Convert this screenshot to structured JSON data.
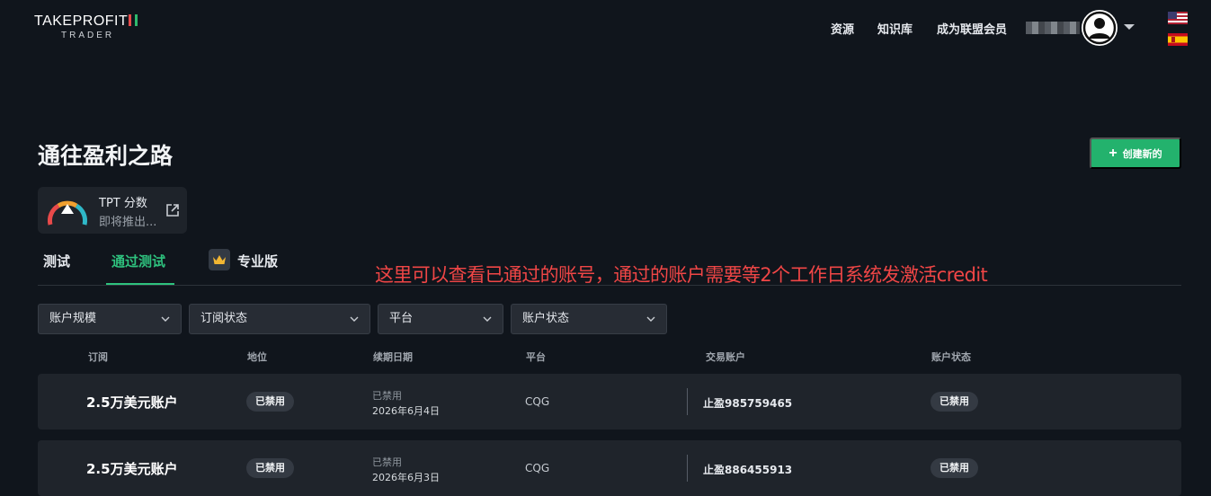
{
  "header": {
    "logo_top": "TAKEPROFIT",
    "logo_sub": "TRADER",
    "nav": [
      "资源",
      "知识库",
      "成为联盟会员"
    ],
    "avatar_icon": "user-circle-icon",
    "languages": [
      "us-flag-icon",
      "es-flag-icon"
    ]
  },
  "page": {
    "title": "通往盈利之路",
    "create_button": "创建新的",
    "create_color": "#23b26d"
  },
  "score_card": {
    "title": "TPT 分数",
    "subtitle": "即将推出...",
    "icon": "gauge-icon",
    "link_icon": "external-link-icon"
  },
  "tabs": [
    {
      "label": "测试",
      "active": false
    },
    {
      "label": "通过测试",
      "active": true
    },
    {
      "label": "专业版",
      "active": false,
      "icon": "crown-icon"
    }
  ],
  "annotation": "这里可以查看已通过的账号，通过的账户需要等2个工作日系统发激活credit",
  "filters": [
    "账户规模",
    "订阅状态",
    "平台",
    "账户状态"
  ],
  "table": {
    "headers": [
      "订阅",
      "地位",
      "续期日期",
      "平台",
      "交易账户",
      "账户状态"
    ],
    "rows": [
      {
        "subscription": "2.5万美元账户",
        "status": "已禁用",
        "renewal_label": "已禁用",
        "renewal_date": "2026年6月4日",
        "platform": "CQG",
        "trading_account": "止盈985759465",
        "account_status": "已禁用"
      },
      {
        "subscription": "2.5万美元账户",
        "status": "已禁用",
        "renewal_label": "已禁用",
        "renewal_date": "2026年6月3日",
        "platform": "CQG",
        "trading_account": "止盈886455913",
        "account_status": "已禁用"
      }
    ]
  },
  "colors": {
    "background": "#10151c",
    "accent_green": "#2ec27e",
    "annotation_red": "#f04646"
  }
}
